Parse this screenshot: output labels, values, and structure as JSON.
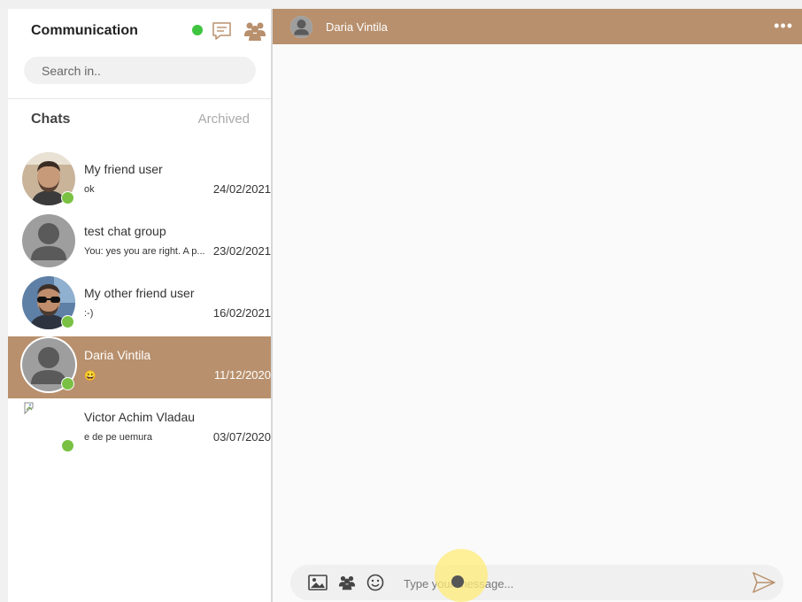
{
  "sidebar": {
    "title": "Communication",
    "search_placeholder": "Search in..",
    "tabs": {
      "chats": "Chats",
      "archived": "Archived"
    },
    "icons": [
      "chat-bubble-icon",
      "group-icon"
    ],
    "chats": [
      {
        "name": "My friend user",
        "preview": "ok",
        "date": "24/02/2021",
        "avatar": "photo-man-beard",
        "online": true
      },
      {
        "name": "test chat group",
        "preview": "You: yes you are right. A p...",
        "date": "23/02/2021",
        "avatar": "default-avatar",
        "online": false
      },
      {
        "name": "My other friend user",
        "preview": ":-)",
        "date": "16/02/2021",
        "avatar": "photo-man-sunglasses",
        "online": true
      },
      {
        "name": "Daria Vintila",
        "preview": "😀",
        "date": "11/12/2020",
        "avatar": "default-avatar",
        "online": true,
        "active": true
      },
      {
        "name": "Victor Achim Vladau",
        "preview": "e de pe uemura",
        "date": "03/07/2020",
        "avatar": "broken-image",
        "online": true
      }
    ]
  },
  "conversation": {
    "contact_name": "Daria Vintila",
    "more_label": "•••"
  },
  "composer": {
    "placeholder": "Type your message...",
    "icons": [
      "image-icon",
      "group-icon",
      "emoji-icon",
      "send-icon"
    ]
  },
  "colors": {
    "accent": "#b8906d",
    "online": "#7ac143",
    "presence": "#3fc43f"
  }
}
